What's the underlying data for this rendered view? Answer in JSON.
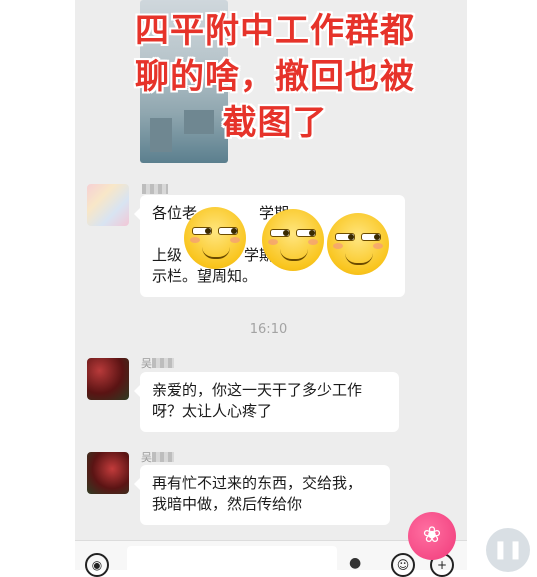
{
  "headline": {
    "lines": [
      "四平附中工作群都",
      "聊的啥，撤回也被",
      "截图了"
    ]
  },
  "messages": [
    {
      "sender_name": "",
      "lines": [
        "各位老",
        "上级",
        "示栏。望周知。"
      ],
      "line_tails": [
        "学期",
        "学期"
      ]
    },
    {
      "sender_name": "吴",
      "lines": [
        "亲爱的，你这一天干了多少工作",
        "呀？太让人心疼了"
      ]
    },
    {
      "sender_name": "吴",
      "lines": [
        "再有忙不过来的东西，交给我，",
        "我暗中做，然后传给你"
      ]
    }
  ],
  "timestamp": "16:10",
  "icons": [
    "voice-icon",
    "emoji-face-icon",
    "plus-icon",
    "microphone-icon"
  ],
  "colors": {
    "headline": "#e6332a",
    "chat_background": "#ededed",
    "bubble": "#ffffff"
  }
}
